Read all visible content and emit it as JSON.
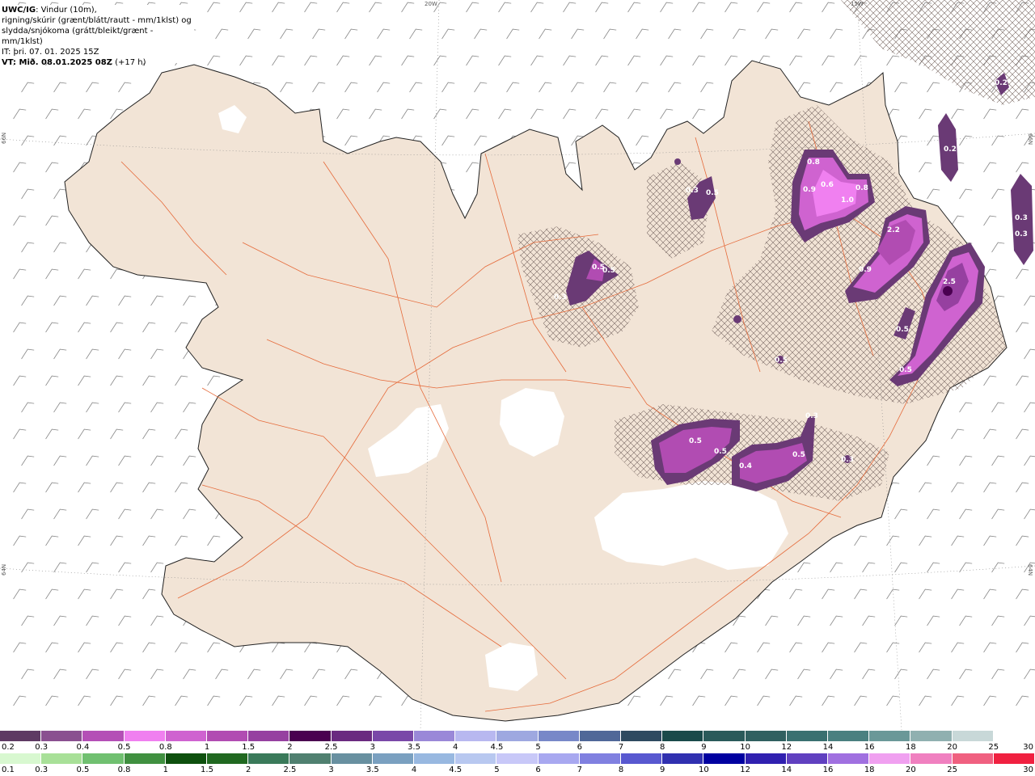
{
  "info": {
    "model": "UWC/IG",
    "line1_rest": ": Vindur (10m),",
    "line2": "rigning/skúrir (grænt/blátt/rautt - mm/1klst) og",
    "line3": "slydda/snjókoma (grátt/bleikt/grænt - mm/1klst)",
    "line4": "IT: þri. 07. 01. 2025 15Z",
    "line5_bold": "VT: Mið. 08.01.2025 08Z",
    "line5_rest": " (+17 h)"
  },
  "coords": {
    "top_a": "20W",
    "top_b": "15W",
    "left_a": "66N",
    "left_b": "64N",
    "right_a": "66N",
    "right_b": "64N"
  },
  "precip_labels": [
    {
      "text": "0.8"
    },
    {
      "text": "0.9"
    },
    {
      "text": "0.6"
    },
    {
      "text": "0.8"
    },
    {
      "text": "1.0"
    },
    {
      "text": "2.2"
    },
    {
      "text": "0.9"
    },
    {
      "text": "2.5"
    },
    {
      "text": "0.5"
    },
    {
      "text": "0.5"
    },
    {
      "text": "0.3"
    },
    {
      "text": "0.5"
    },
    {
      "text": "0.5"
    },
    {
      "text": "0.3"
    },
    {
      "text": "0.5"
    },
    {
      "text": "0.5"
    },
    {
      "text": "0.5"
    },
    {
      "text": "0.4"
    },
    {
      "text": "0.5"
    },
    {
      "text": "0.3"
    },
    {
      "text": "0.3"
    },
    {
      "text": "0.2"
    },
    {
      "text": "0.3"
    },
    {
      "text": "0.3"
    },
    {
      "text": "0.2"
    },
    {
      "text": "0.5"
    }
  ],
  "legend_snow": {
    "colors": [
      "#5e3a63",
      "#8a5090",
      "#b44fb6",
      "#f080f0",
      "#cf63d0",
      "#b14cb2",
      "#9640a0",
      "#4a0050",
      "#6a2a80",
      "#7a48a8",
      "#9a88d8",
      "#b8b8f0",
      "#9ea8e0",
      "#7888c8",
      "#506898",
      "#2e4a60",
      "#1a4a4a",
      "#2a5a5a",
      "#306060",
      "#3a7070",
      "#4a8080",
      "#6a9898",
      "#90b0b0",
      "#c8d8d8",
      "#ffffff"
    ],
    "labels": [
      "0.2",
      "0.3",
      "0.4",
      "0.5",
      "0.8",
      "1",
      "1.5",
      "2",
      "2.5",
      "3",
      "3.5",
      "4",
      "4.5",
      "5",
      "6",
      "7",
      "8",
      "9",
      "10",
      "12",
      "14",
      "16",
      "18",
      "20",
      "25",
      "30"
    ]
  },
  "legend_rain": {
    "colors": [
      "#d8f8d0",
      "#a8e098",
      "#70c070",
      "#409040",
      "#0e500e",
      "#206820",
      "#3a7a5a",
      "#508070",
      "#6890a0",
      "#7aa0c0",
      "#98b8e0",
      "#b8c8f0",
      "#c8c8f8",
      "#a8a8f0",
      "#8080e0",
      "#5858d0",
      "#3030b0",
      "#0000a0",
      "#3020b0",
      "#6040c0",
      "#a070e0",
      "#f0a0f0",
      "#f080c0",
      "#f06080",
      "#f02040"
    ],
    "labels": [
      "0.1",
      "0.3",
      "0.5",
      "0.8",
      "1",
      "1.5",
      "2",
      "2.5",
      "3",
      "3.5",
      "4",
      "4.5",
      "5",
      "6",
      "7",
      "8",
      "9",
      "10",
      "12",
      "14",
      "16",
      "18",
      "20",
      "25",
      "30"
    ]
  }
}
